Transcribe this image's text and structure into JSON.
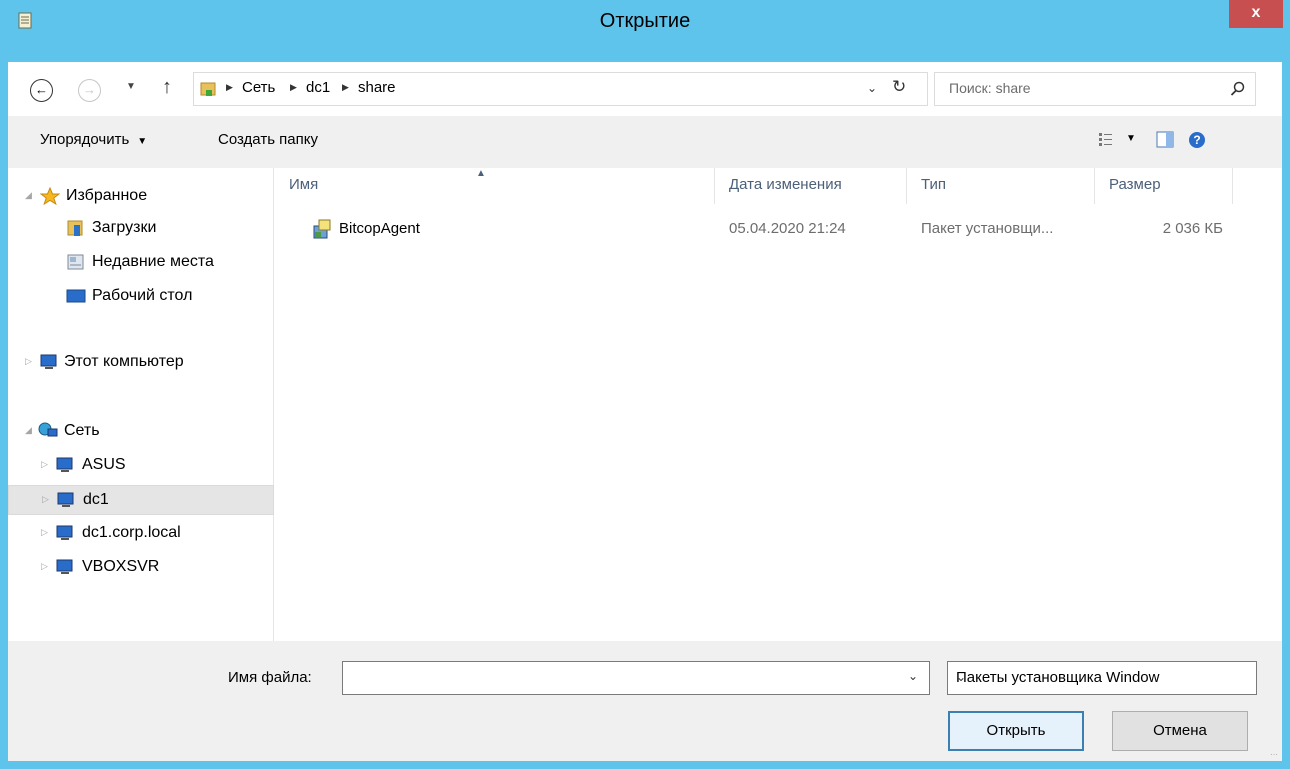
{
  "window": {
    "title": "Открытие",
    "close_label": "x",
    "accent": "#5ec4ec"
  },
  "address": {
    "crumbs": [
      "Сеть",
      "dc1",
      "share"
    ],
    "search_placeholder": "Поиск: share"
  },
  "toolbar": {
    "organize_label": "Упорядочить",
    "new_folder_label": "Создать папку"
  },
  "nav": {
    "favorites_label": "Избранное",
    "downloads_label": "Загрузки",
    "recent_label": "Недавние места",
    "desktop_label": "Рабочий стол",
    "computer_label": "Этот компьютер",
    "network_label": "Сеть",
    "hosts": [
      "ASUS",
      "dc1",
      "dc1.corp.local",
      "VBOXSVR"
    ],
    "selected_host": "dc1"
  },
  "columns": {
    "name": "Имя",
    "date": "Дата изменения",
    "type": "Тип",
    "size": "Размер"
  },
  "files": [
    {
      "name": "BitcopAgent",
      "date": "05.04.2020 21:24",
      "type": "Пакет установщи...",
      "size": "2 036 КБ",
      "icon": "installer-package-icon"
    }
  ],
  "bottom": {
    "filename_label": "Имя файла:",
    "filename_value": "",
    "filter_value": "Пакеты установщика Window",
    "open_label": "Открыть",
    "cancel_label": "Отмена"
  }
}
